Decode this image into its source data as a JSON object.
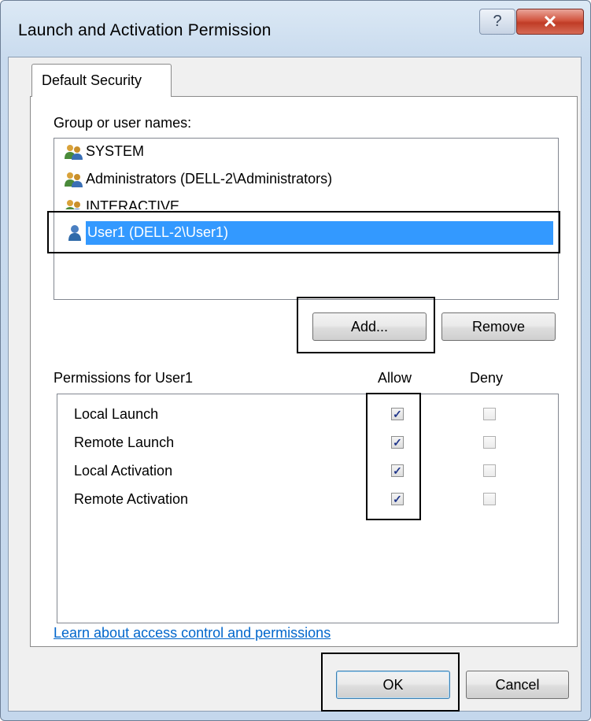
{
  "window": {
    "title": "Launch and Activation Permission",
    "help_glyph": "?",
    "close_glyph": "✕"
  },
  "tabs": [
    {
      "label": "Default Security"
    }
  ],
  "group_section": {
    "label": "Group or user names:",
    "items": [
      {
        "name": "SYSTEM",
        "icon": "group-users-icon",
        "selected": false
      },
      {
        "name": "Administrators (DELL-2\\Administrators)",
        "icon": "group-users-icon",
        "selected": false
      },
      {
        "name": "INTERACTIVE",
        "icon": "group-users-icon",
        "selected": false
      },
      {
        "name": "User1 (DELL-2\\User1)",
        "icon": "user-icon",
        "selected": true
      }
    ],
    "add_button": "Add...",
    "remove_button": "Remove"
  },
  "permissions": {
    "label": "Permissions for User1",
    "allow_header": "Allow",
    "deny_header": "Deny",
    "rows": [
      {
        "name": "Local Launch",
        "allow": true,
        "deny": false
      },
      {
        "name": "Remote Launch",
        "allow": true,
        "deny": false
      },
      {
        "name": "Local Activation",
        "allow": true,
        "deny": false
      },
      {
        "name": "Remote Activation",
        "allow": true,
        "deny": false
      }
    ]
  },
  "link": "Learn about access control and permissions",
  "footer": {
    "ok": "OK",
    "cancel": "Cancel"
  },
  "colors": {
    "selection": "#3399ff",
    "link": "#0066cc",
    "close_button": "#c03c26"
  }
}
